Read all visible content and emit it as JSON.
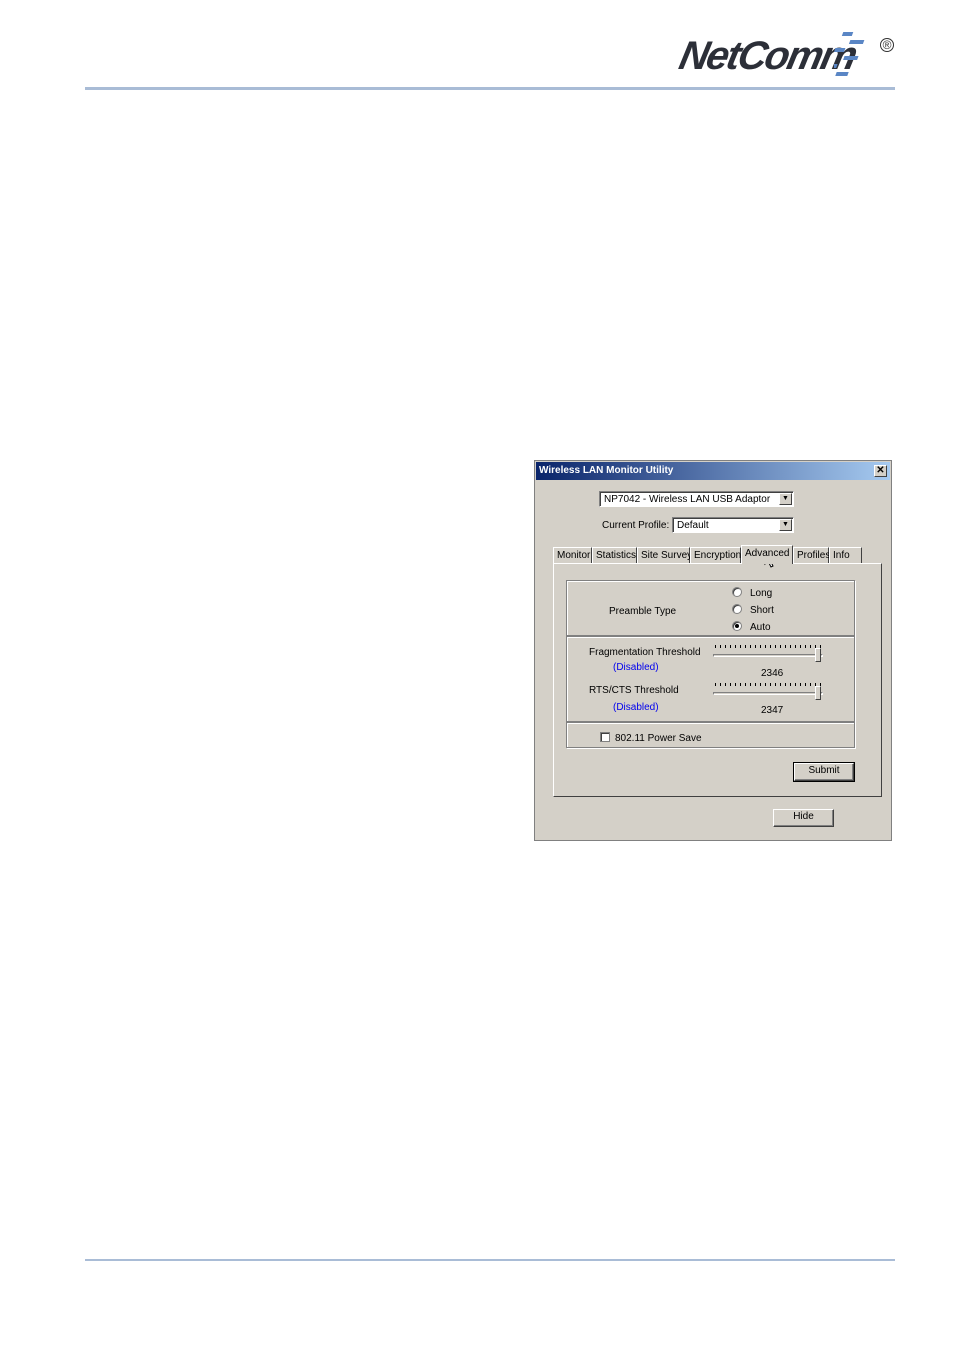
{
  "header": {
    "logo_text": "NetComm",
    "registered_mark": "®"
  },
  "window": {
    "title": "Wireless LAN Monitor Utility",
    "close_glyph": "✕",
    "adapter_select": {
      "value": "NP7042 - Wireless LAN USB Adaptor"
    },
    "profile": {
      "label": "Current Profile:",
      "value": "Default"
    },
    "tabs": [
      {
        "label": "Monitor"
      },
      {
        "label": "Statistics"
      },
      {
        "label": "Site Survey"
      },
      {
        "label": "Encryption"
      },
      {
        "label": "Advanced",
        "active": true
      },
      {
        "label": "Profiles"
      },
      {
        "label": "Info"
      }
    ],
    "preamble": {
      "label": "Preamble Type",
      "options": [
        "Long",
        "Short",
        "Auto"
      ],
      "selected": "Auto"
    },
    "fragmentation": {
      "label": "Fragmentation Threshold",
      "status": "(Disabled)",
      "value": "2346",
      "level": 1.0
    },
    "rts": {
      "label": "RTS/CTS Threshold",
      "status": "(Disabled)",
      "value": "2347",
      "level": 1.0
    },
    "power_save": {
      "label": "802.11 Power Save",
      "checked": false
    },
    "submit_label": "Submit",
    "hide_label": "Hide",
    "dropdown_arrow": "▼"
  }
}
